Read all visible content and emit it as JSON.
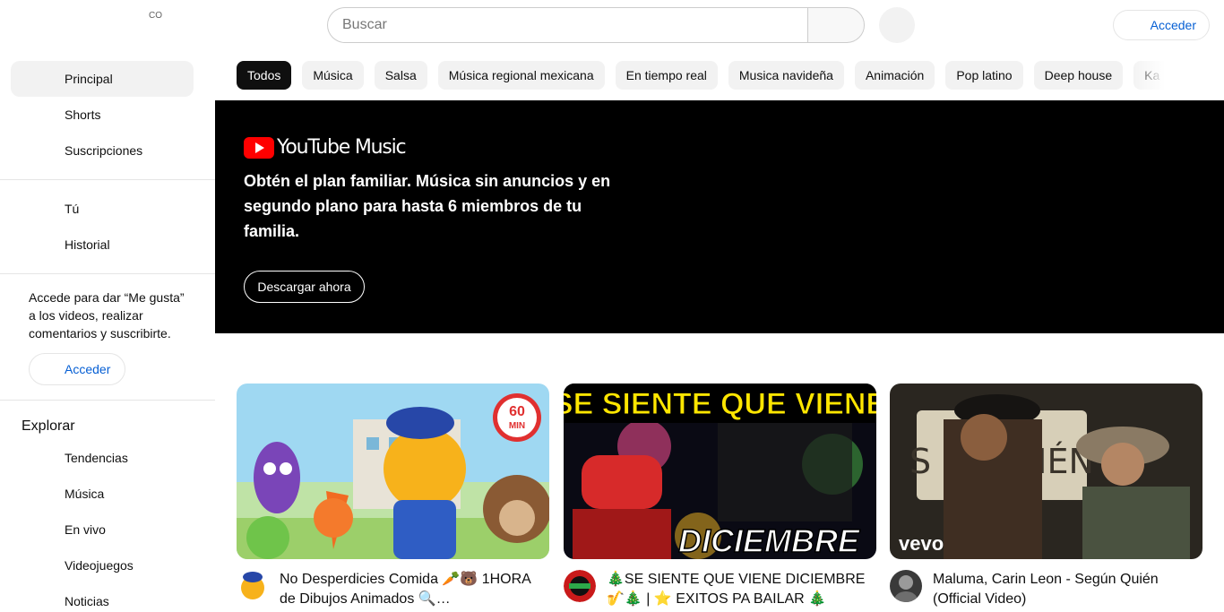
{
  "header": {
    "country_code": "CO",
    "search_placeholder": "Buscar",
    "acceder_label": "Acceder"
  },
  "sidebar": {
    "primary": [
      {
        "label": "Principal",
        "icon": "home-icon",
        "active": true
      },
      {
        "label": "Shorts",
        "icon": "shorts-icon",
        "active": false
      },
      {
        "label": "Suscripciones",
        "icon": "subscriptions-icon",
        "active": false
      }
    ],
    "you": [
      {
        "label": "Tú",
        "icon": "you-icon"
      },
      {
        "label": "Historial",
        "icon": "history-icon"
      }
    ],
    "signin_text": "Accede para dar “Me gusta” a los videos, realizar comentarios y suscribirte.",
    "signin_button": "Acceder",
    "explore_title": "Explorar",
    "explore": [
      {
        "label": "Tendencias",
        "icon": "trending-icon"
      },
      {
        "label": "Música",
        "icon": "music-icon"
      },
      {
        "label": "En vivo",
        "icon": "live-icon"
      },
      {
        "label": "Videojuegos",
        "icon": "gaming-icon"
      },
      {
        "label": "Noticias",
        "icon": "news-icon"
      }
    ]
  },
  "chips": [
    "Todos",
    "Música",
    "Salsa",
    "Música regional mexicana",
    "En tiempo real",
    "Musica navideña",
    "Animación",
    "Pop latino",
    "Deep house",
    "Ka"
  ],
  "banner": {
    "logo_text": "YouTube Music",
    "text": "Obtén el plan familiar. Música sin anuncios y en segundo plano para hasta 6 miembros de tu familia.",
    "button": "Descargar ahora"
  },
  "videos": [
    {
      "title": "No Desperdicies Comida 🥕🐻 1HORA de Dibujos Animados 🔍…",
      "badge": "60 MIN"
    },
    {
      "title": "🎄SE SIENTE QUE VIENE DICIEMBRE 🎷🎄 | ⭐ EXITOS PA BAILAR 🎄",
      "thumb_top": "SE SIENTE QUE VIENE",
      "thumb_bottom": "DICIEMBRE"
    },
    {
      "title": "Maluma, Carin Leon - Según Quién (Official Video)",
      "thumb_sign": "S     QUIÉN",
      "thumb_brand": "vevo"
    }
  ]
}
